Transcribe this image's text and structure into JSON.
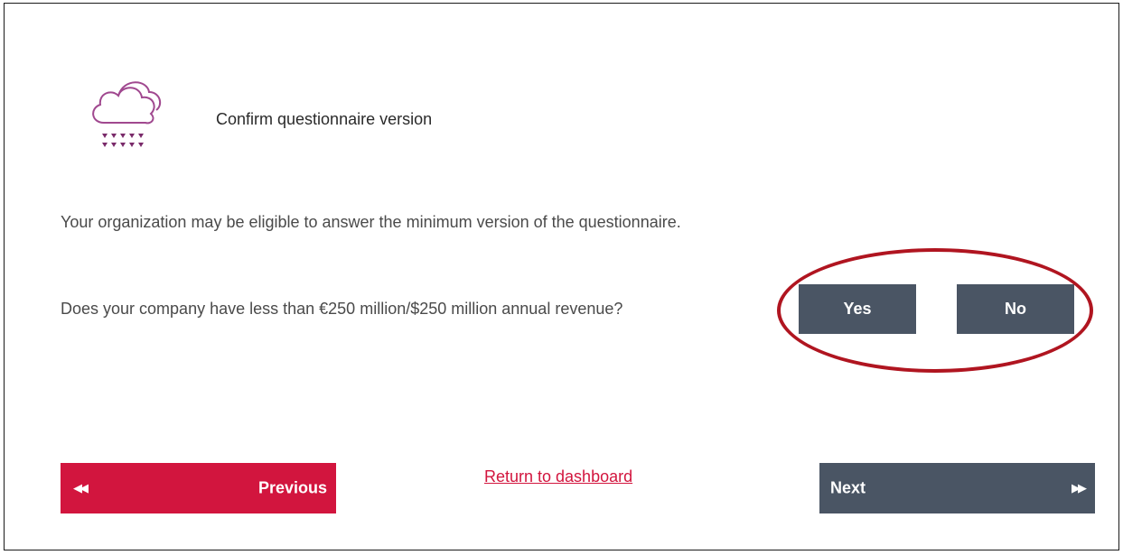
{
  "page": {
    "title": "Confirm questionnaire version",
    "icon": "cloud-rain-icon"
  },
  "content": {
    "intro_text": "Your organization may be eligible to answer the minimum version of the questionnaire.",
    "question_text": "Does your company have less than €250 million/$250 million annual revenue?"
  },
  "answers": {
    "yes_label": "Yes",
    "no_label": "No"
  },
  "navigation": {
    "previous_label": "Previous",
    "previous_icon": "double-chevron-left-icon",
    "return_label": "Return to dashboard",
    "next_label": "Next",
    "next_icon": "double-chevron-right-icon"
  },
  "colors": {
    "accent": "#d2153e",
    "button_dark": "#4a5564",
    "highlight_ring": "#b01520",
    "icon": "#a0488f"
  }
}
